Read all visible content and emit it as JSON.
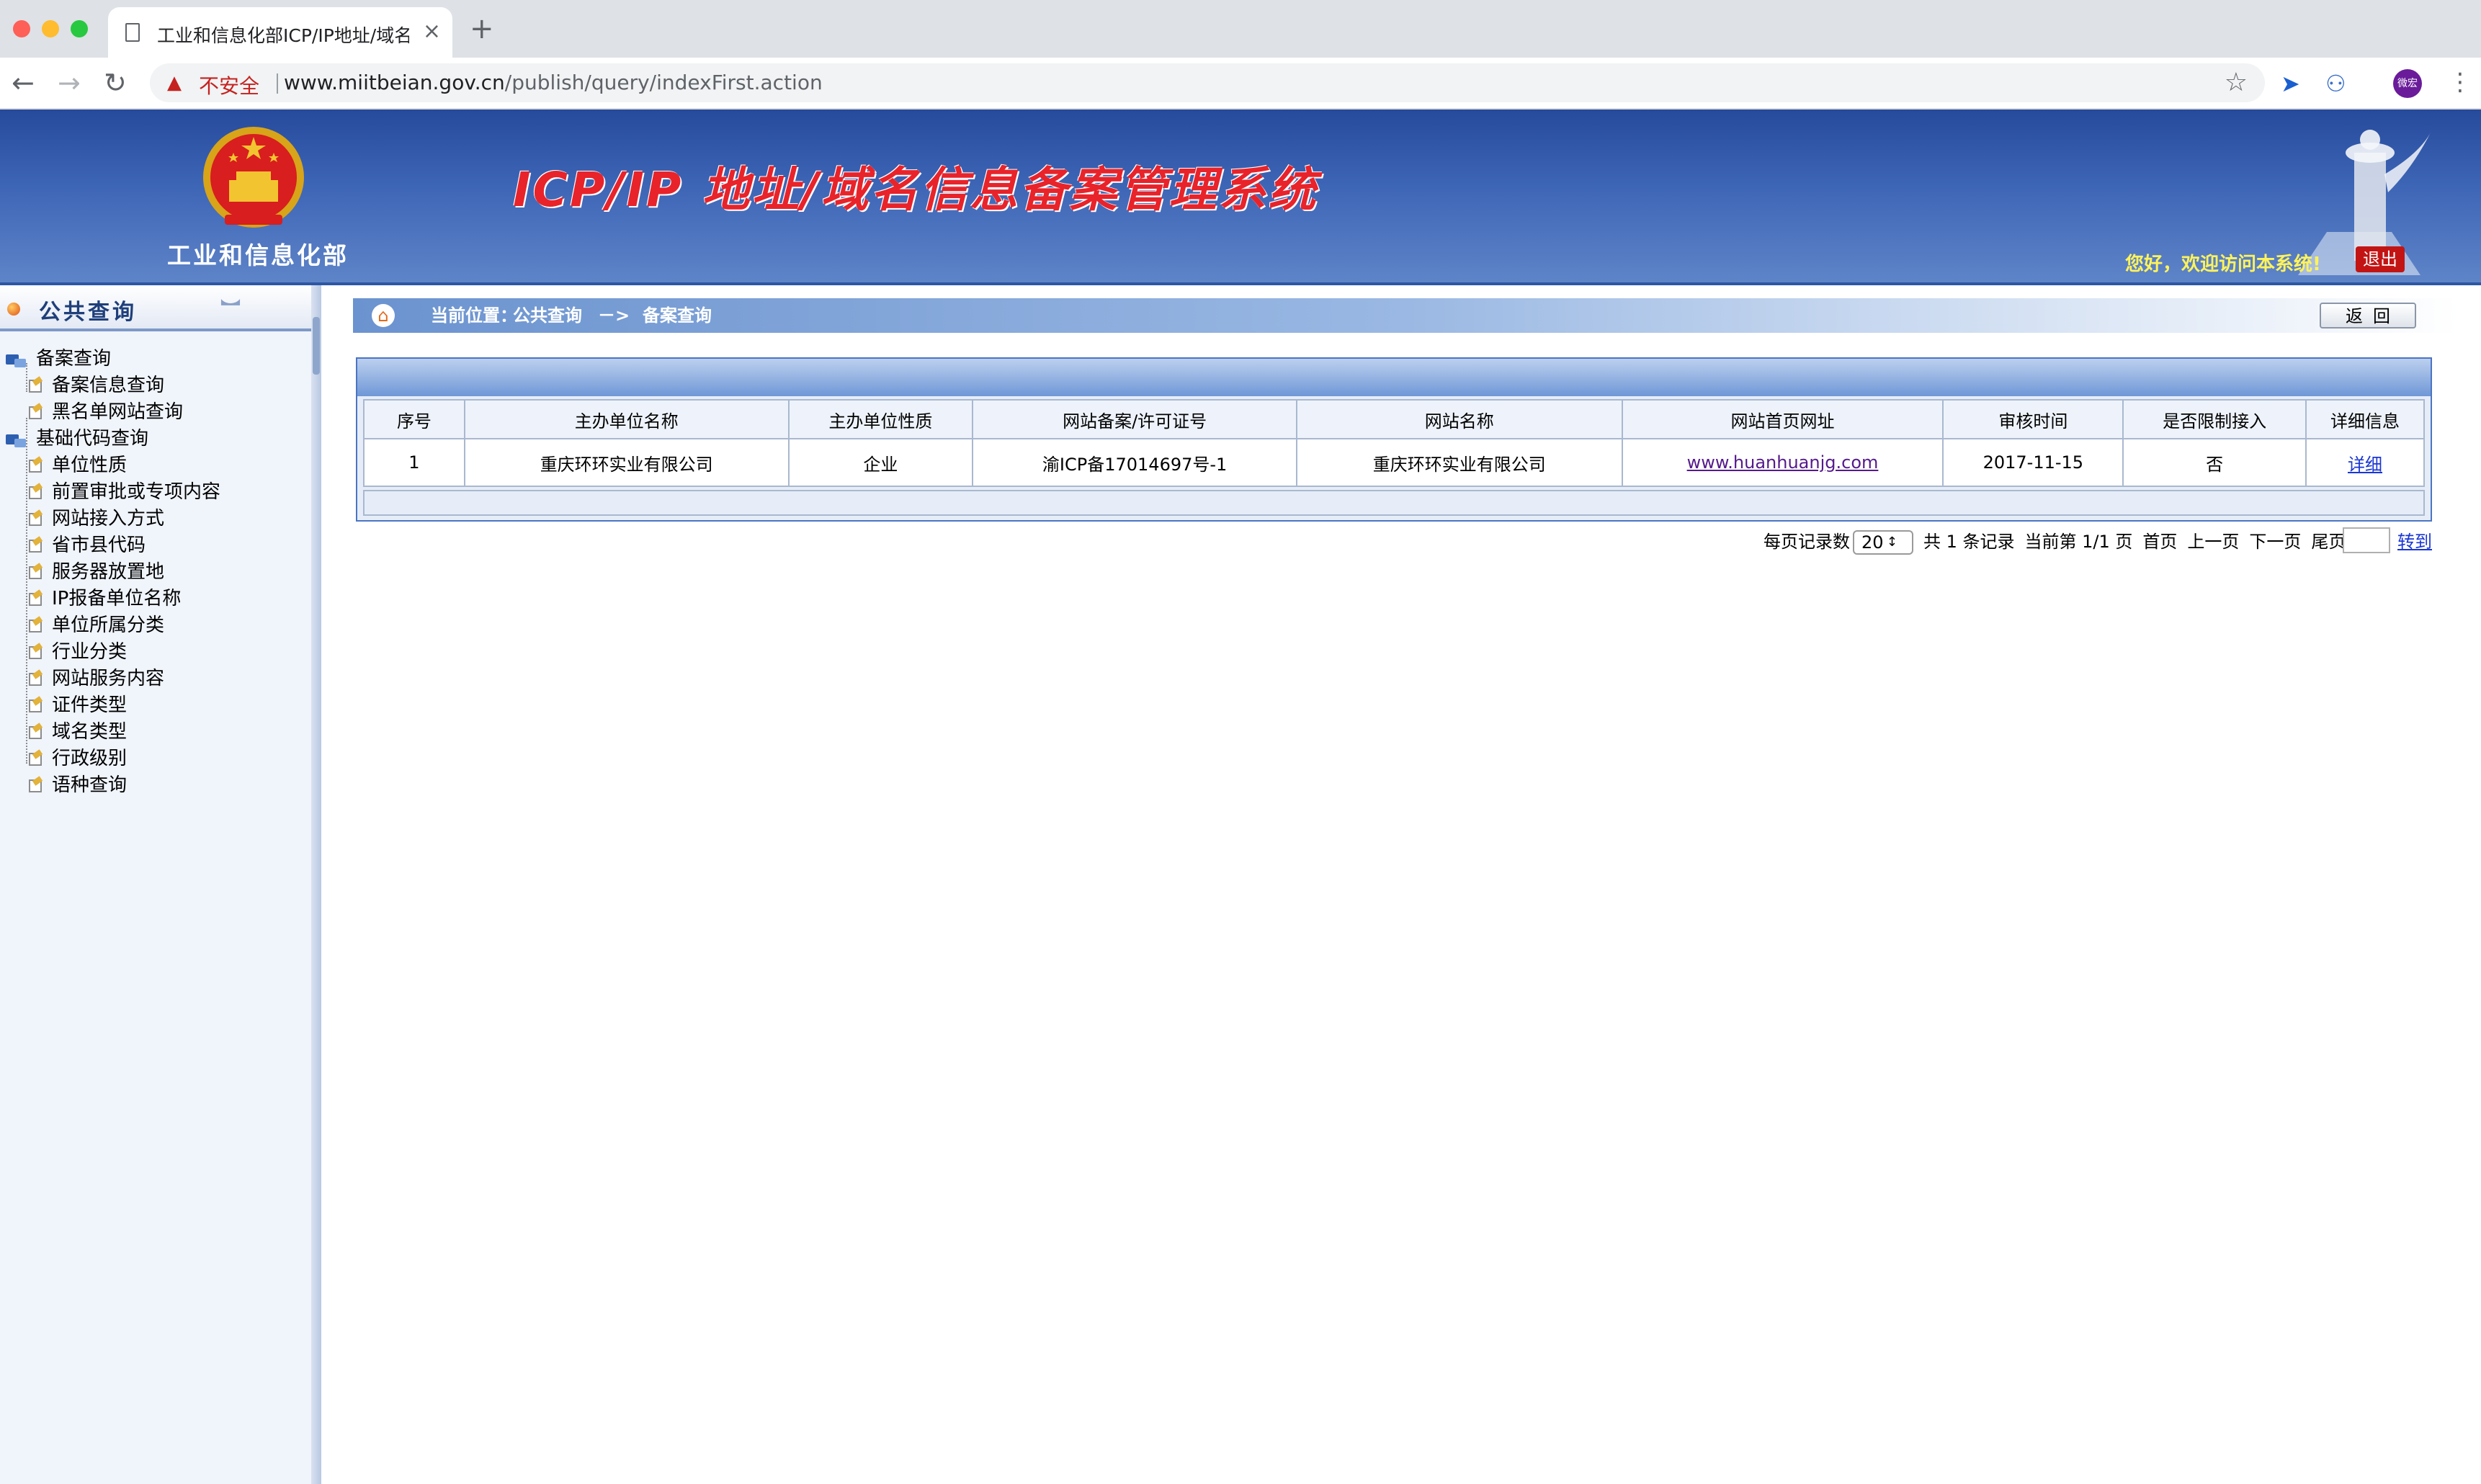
{
  "browser": {
    "tab_title": "工业和信息化部ICP/IP地址/域名",
    "tab_close": "×",
    "new_tab": "+",
    "security_label": "不安全",
    "url_host": "www.miitbeian.gov.cn",
    "url_path": "/publish/query/indexFirst.action",
    "profile_label": "微宏",
    "traffic_colors": [
      "#fe5f57",
      "#febc2e",
      "#28c840"
    ]
  },
  "header": {
    "ministry_name": "工业和信息化部",
    "system_title": "ICP/IP 地址/域名信息备案管理系统",
    "welcome_text": "您好，欢迎访问本系统!",
    "logout_label": "退出"
  },
  "sidebar": {
    "title": "公共查询",
    "groups": [
      {
        "label": "备案查询",
        "items": [
          "备案信息查询",
          "黑名单网站查询"
        ]
      },
      {
        "label": "基础代码查询",
        "items": [
          "单位性质",
          "前置审批或专项内容",
          "网站接入方式",
          "省市县代码",
          "服务器放置地",
          "IP报备单位名称",
          "单位所属分类",
          "行业分类",
          "网站服务内容",
          "证件类型",
          "域名类型",
          "行政级别",
          "语种查询"
        ]
      }
    ]
  },
  "breadcrumb": {
    "prefix": "当前位置：",
    "level1": "公共查询",
    "arrow": "－>",
    "level2": "备案查询"
  },
  "back_button": "返回",
  "table": {
    "headers": [
      "序号",
      "主办单位名称",
      "主办单位性质",
      "网站备案/许可证号",
      "网站名称",
      "网站首页网址",
      "审核时间",
      "是否限制接入",
      "详细信息"
    ],
    "rows": [
      {
        "index": "1",
        "org_name": "重庆环环实业有限公司",
        "org_type": "企业",
        "license": "渝ICP备17014697号-1",
        "site_name": "重庆环环实业有限公司",
        "site_url": "www.huanhuanjg.com",
        "audit_date": "2017-11-15",
        "restricted": "否",
        "detail": "详细"
      }
    ]
  },
  "pager": {
    "per_page_label": "每页记录数",
    "per_page_value": "20",
    "total": "共 1 条记录",
    "current": "当前第 1/1 页",
    "first": "首页",
    "prev": "上一页",
    "next": "下一页",
    "last": "尾页",
    "goto": "转到"
  }
}
